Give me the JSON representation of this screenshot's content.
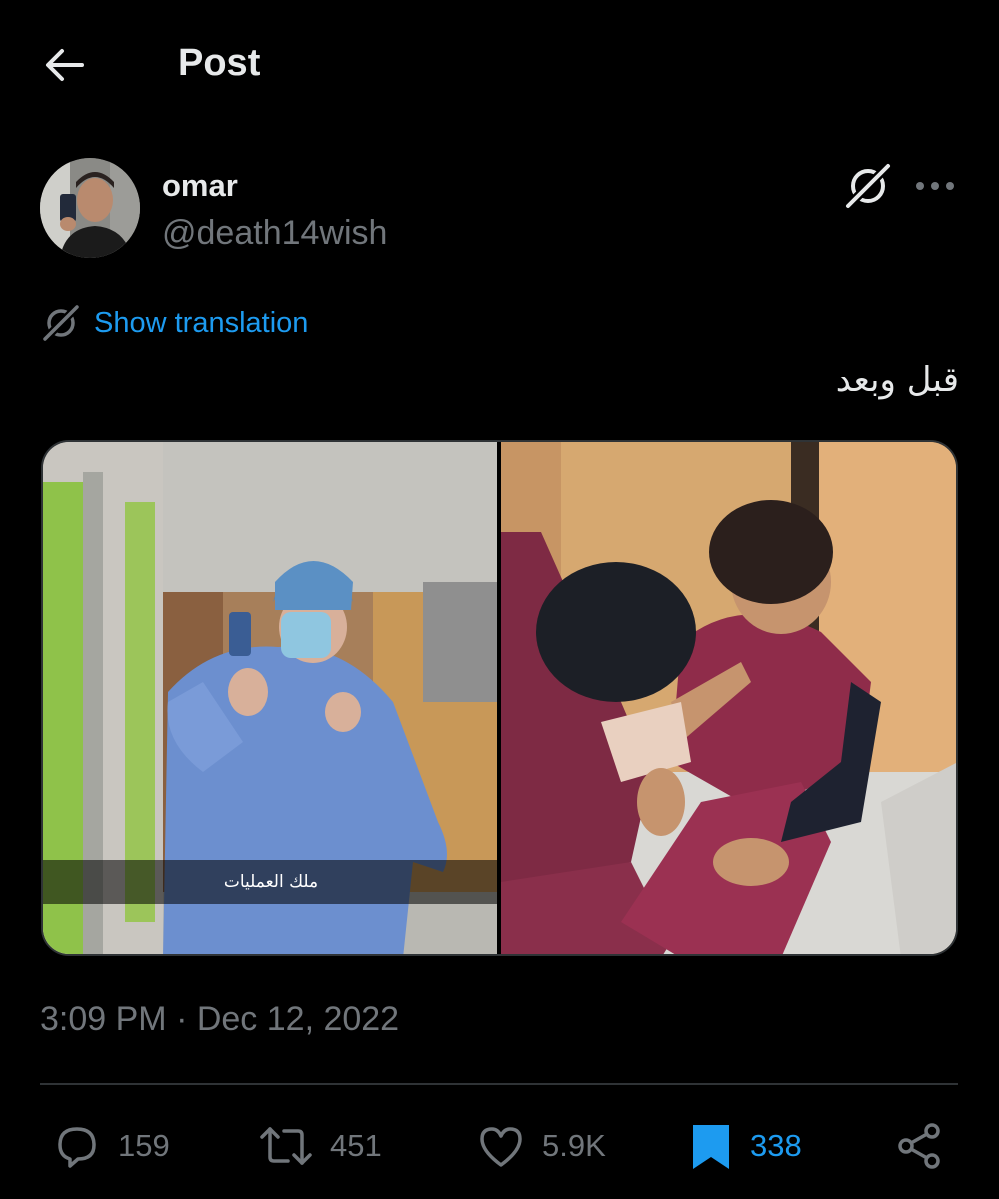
{
  "header": {
    "title": "Post",
    "back_icon": "arrow-left-icon"
  },
  "author": {
    "display_name": "omar",
    "handle": "@death14wish",
    "avatar_icon": "avatar"
  },
  "translate": {
    "label": "Show translation"
  },
  "post": {
    "text": "قبل وبعد",
    "media_caption": "ملك العمليات"
  },
  "meta": {
    "timestamp": "3:09 PM · Dec 12, 2022"
  },
  "actions": {
    "replies": "159",
    "reposts": "451",
    "likes": "5.9K",
    "bookmarks": "338"
  },
  "colors": {
    "accent": "#1d9bf0",
    "muted": "#71767b",
    "background": "#000000",
    "text": "#e7e9ea"
  }
}
